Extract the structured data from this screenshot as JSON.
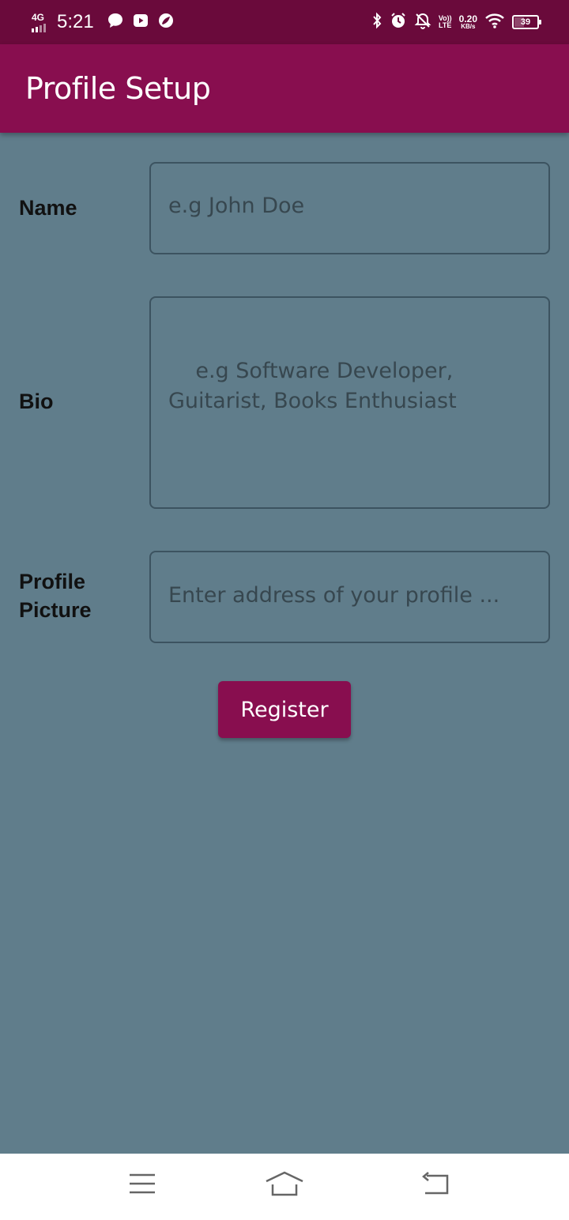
{
  "status_bar": {
    "network_type": "4G",
    "time": "5:21",
    "volte_top": "Vo))",
    "volte_bottom": "LTE",
    "speed_value": "0.20",
    "speed_unit": "KB/s",
    "battery_level": "39",
    "left_icons": [
      "message-icon",
      "youtube-icon",
      "leaf-icon"
    ],
    "right_icons": [
      "bluetooth-icon",
      "alarm-icon",
      "notifications-off-icon",
      "volte-icon",
      "wifi-icon",
      "battery-icon"
    ]
  },
  "app_bar": {
    "title": "Profile Setup",
    "color": "#880e4f"
  },
  "form": {
    "name": {
      "label": "Name",
      "placeholder": "e.g John Doe"
    },
    "bio": {
      "label": "Bio",
      "placeholder": "e.g Software Developer, Guitarist, Books Enthusiast"
    },
    "profile_picture": {
      "label": "Profile Picture",
      "placeholder": "Enter address of your profile ..."
    },
    "register_label": "Register"
  },
  "nav_bar": {
    "icons": [
      "menu-icon",
      "home-icon",
      "back-icon"
    ]
  },
  "colors": {
    "background": "#607d8b",
    "primary": "#880e4f",
    "status_bar": "#6a0a3b"
  }
}
